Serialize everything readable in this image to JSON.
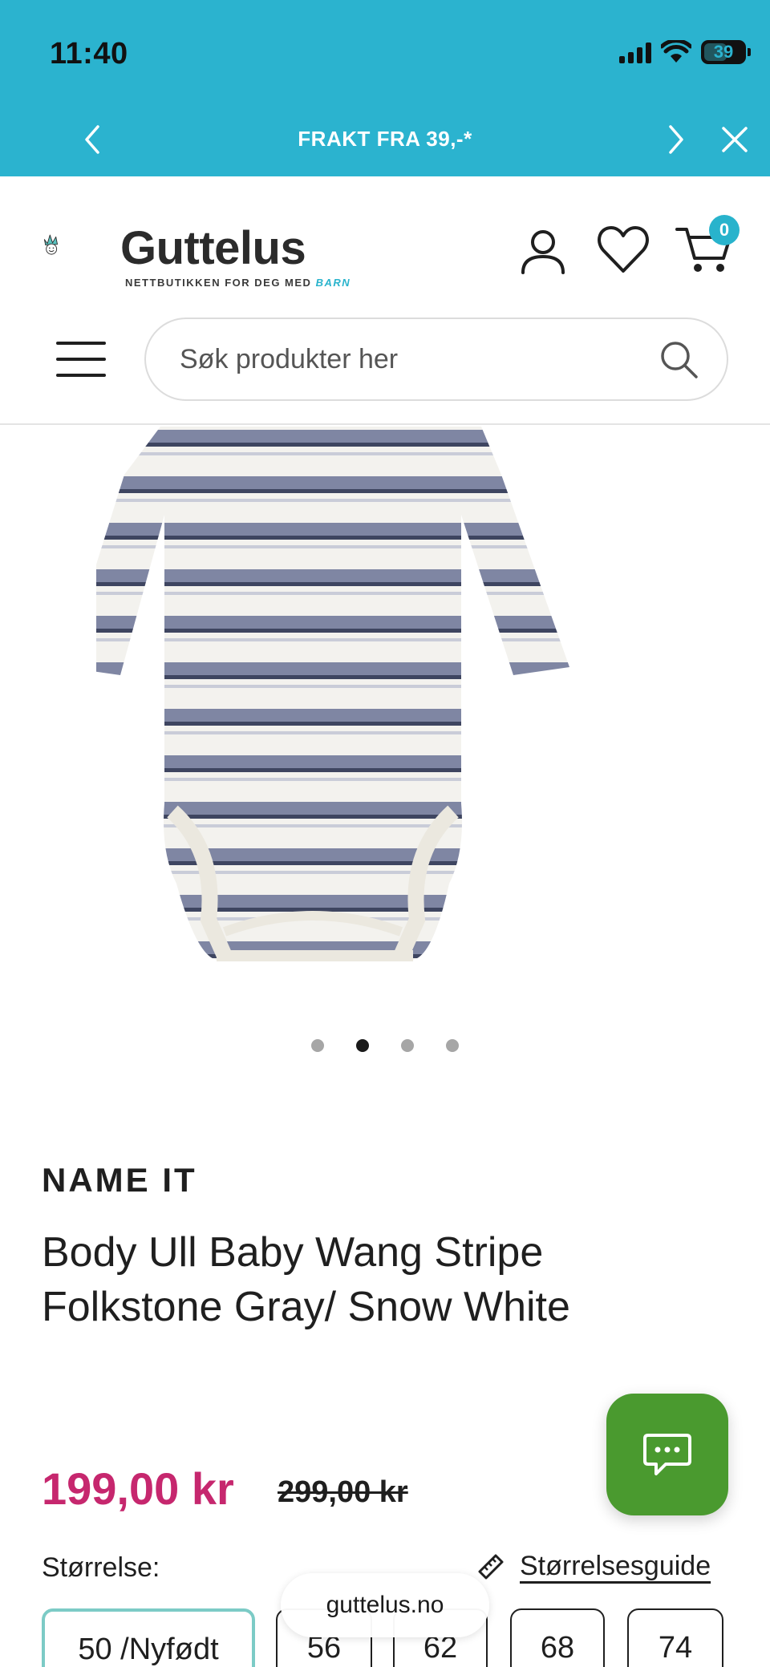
{
  "status_bar": {
    "time": "11:40",
    "battery": "39"
  },
  "announcement": {
    "text": "FRAKT FRA 39,-*",
    "prev_icon": "chevron-left-icon",
    "next_icon": "chevron-right-icon",
    "close_icon": "close-icon"
  },
  "header": {
    "logo_name": "Guttelus",
    "logo_tagline": "NETTBUTIKKEN FOR DEG MED",
    "logo_tagline_accent": "BARN",
    "cart_count": "0",
    "search_placeholder": "Søk produkter her"
  },
  "gallery": {
    "slide_count": 4,
    "active_index": 1
  },
  "product": {
    "brand": "NAME IT",
    "title": "Body Ull Baby Wang Stripe Folkstone Gray/ Snow White",
    "price": "199,00 kr",
    "old_price": "299,00 kr"
  },
  "sizes": {
    "label": "Størrelse:",
    "guide_label": "Størrelsesguide",
    "options": [
      "50 /Nyfødt",
      "56",
      "62",
      "68",
      "74"
    ],
    "selected": "50 /Nyfødt"
  },
  "browser": {
    "url": "guttelus.no"
  },
  "colors": {
    "top_bar": "#2bb3cf",
    "price": "#c6276e",
    "chat": "#4a9a2f",
    "accent": "#28b3cc"
  }
}
